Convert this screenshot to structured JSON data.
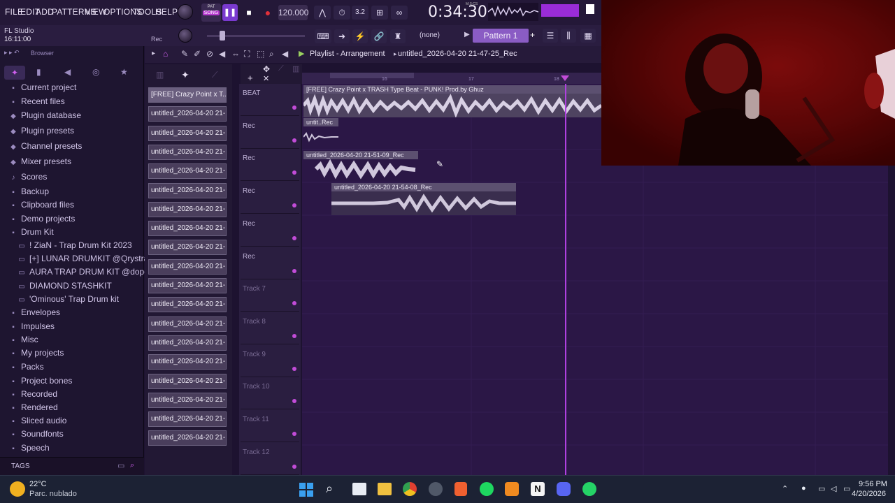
{
  "menu": [
    "FILE",
    "EDIT",
    "ADD",
    "PATTERNS",
    "VIEW",
    "OPTIONS",
    "TOOLS",
    "HELP"
  ],
  "transport": {
    "mode_top": "PAT",
    "mode_bottom": "SONG",
    "tempo": "120.000",
    "time": "0:34:30",
    "time_unit": "M:S:CS"
  },
  "hint_panel": {
    "app": "FL Studio",
    "time": "16:11:00",
    "rec": "Rec"
  },
  "snap": {
    "value": "(none)"
  },
  "pattern": {
    "label": "Pattern 1"
  },
  "browser": {
    "title": "Browser",
    "items": [
      {
        "label": "Current project",
        "icon": "folder"
      },
      {
        "label": "Recent files",
        "icon": "folder"
      },
      {
        "label": "Plugin database",
        "icon": "plug"
      },
      {
        "label": "Plugin presets",
        "icon": "plug"
      },
      {
        "label": "Channel presets",
        "icon": "plug"
      },
      {
        "label": "Mixer presets",
        "icon": "plug"
      },
      {
        "label": "Scores",
        "icon": "note"
      },
      {
        "label": "Backup",
        "icon": "folder"
      },
      {
        "label": "Clipboard files",
        "icon": "folder"
      },
      {
        "label": "Demo projects",
        "icon": "folder"
      },
      {
        "label": "Drum Kit",
        "icon": "folder"
      },
      {
        "label": "! ZiaN - Trap Drum Kit 2023",
        "icon": "subfolder"
      },
      {
        "label": "[+] LUNAR DRUMKIT @Qrystral",
        "icon": "subfolder"
      },
      {
        "label": "AURA TRAP DRUM KIT @dopekit",
        "icon": "subfolder"
      },
      {
        "label": "DIAMOND STASHKIT",
        "icon": "subfolder"
      },
      {
        "label": "'Ominous' Trap Drum kit",
        "icon": "subfolder"
      },
      {
        "label": "Envelopes",
        "icon": "folder"
      },
      {
        "label": "Impulses",
        "icon": "folder"
      },
      {
        "label": "Misc",
        "icon": "folder"
      },
      {
        "label": "My projects",
        "icon": "folder"
      },
      {
        "label": "Packs",
        "icon": "folder"
      },
      {
        "label": "Project bones",
        "icon": "folder"
      },
      {
        "label": "Recorded",
        "icon": "folder"
      },
      {
        "label": "Rendered",
        "icon": "folder"
      },
      {
        "label": "Sliced audio",
        "icon": "folder"
      },
      {
        "label": "Soundfonts",
        "icon": "folder"
      },
      {
        "label": "Speech",
        "icon": "folder"
      }
    ],
    "tags_label": "TAGS"
  },
  "playlist": {
    "breadcrumb": "Playlist - Arrangement",
    "file": "untitled_2026-04-20 21-47-25_Rec",
    "ruler_marks": [
      "16",
      "17",
      "18"
    ],
    "clip_list": [
      "[FREE] Crazy Point x T...",
      "untitled_2026-04-20 21-...",
      "untitled_2026-04-20 21-...",
      "untitled_2026-04-20 21-...",
      "untitled_2026-04-20 21-...",
      "untitled_2026-04-20 21-...",
      "untitled_2026-04-20 21-...",
      "untitled_2026-04-20 21-...",
      "untitled_2026-04-20 21-...",
      "untitled_2026-04-20 21-...",
      "untitled_2026-04-20 21-...",
      "untitled_2026-04-20 21-...",
      "untitled_2026-04-20 21-...",
      "untitled_2026-04-20 21-...",
      "untitled_2026-04-20 21-...",
      "untitled_2026-04-20 21-...",
      "untitled_2026-04-20 21-...",
      "untitled_2026-04-20 21-...",
      "untitled_2026-04-20 21-..."
    ],
    "tracks": [
      "BEAT",
      "Rec",
      "Rec",
      "Rec",
      "Rec",
      "Rec",
      "Track 7",
      "Track 8",
      "Track 9",
      "Track 10",
      "Track 11",
      "Track 12"
    ],
    "clips": [
      {
        "title": "[FREE] Crazy Point x TRASH Type Beat - PUNK! Prod.by Ghuz"
      },
      {
        "title": "untit..Rec"
      },
      {
        "title": "untitled_2026-04-20 21-51-09_Rec"
      },
      {
        "title": "untitled_2026-04-20 21-54-08_Rec"
      }
    ]
  },
  "taskbar": {
    "weather_temp": "22°C",
    "weather_desc": "Parc. nublado",
    "time": "9:56 PM",
    "date": "4/20/2026"
  },
  "colors": {
    "accent": "#c24cd8",
    "grid": "#2b1746",
    "clip": "#4a3e5c",
    "playhead": "#b040e0"
  }
}
